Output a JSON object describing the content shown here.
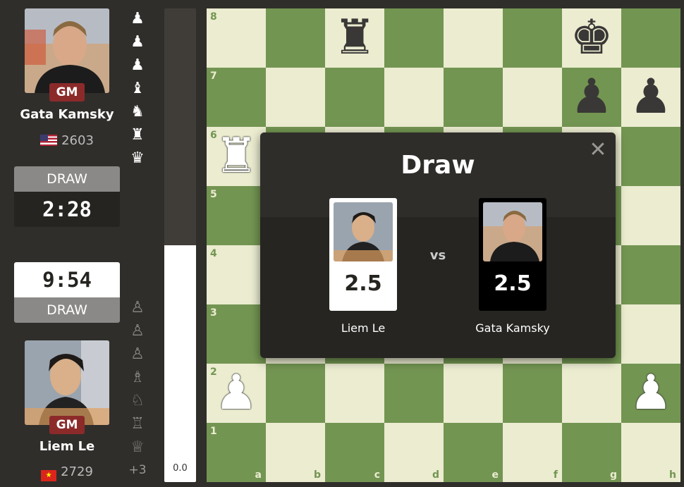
{
  "top_player": {
    "title_badge": "GM",
    "name": "Gata Kamsky",
    "rating": "2603",
    "flag": "us-flag"
  },
  "bottom_player": {
    "title_badge": "GM",
    "name": "Liem Le",
    "rating": "2729",
    "flag": "vn-flag"
  },
  "top_clock": {
    "status": "DRAW",
    "time": "2:28"
  },
  "bottom_clock": {
    "status": "DRAW",
    "time": "9:54"
  },
  "top_captured": [
    "♟",
    "♟",
    "♟",
    "♝",
    "♞",
    "♜",
    "♛"
  ],
  "bottom_captured": [
    "♙",
    "♙",
    "♙",
    "♗",
    "♘",
    "♖",
    "♕"
  ],
  "bottom_advantage": "+3",
  "eval": {
    "score": "0.0",
    "white_fraction": 0.5
  },
  "board": {
    "ranks": [
      "8",
      "7",
      "6",
      "5",
      "4",
      "3",
      "2",
      "1"
    ],
    "files": [
      "a",
      "b",
      "c",
      "d",
      "e",
      "f",
      "g",
      "h"
    ],
    "pieces": [
      {
        "square": "c8",
        "glyph": "♜",
        "color": "black",
        "name": "black-rook-icon"
      },
      {
        "square": "g8",
        "glyph": "♚",
        "color": "black",
        "name": "black-king-icon"
      },
      {
        "square": "g7",
        "glyph": "♟",
        "color": "black",
        "name": "black-pawn-icon"
      },
      {
        "square": "h7",
        "glyph": "♟",
        "color": "black",
        "name": "black-pawn-icon"
      },
      {
        "square": "a6",
        "glyph": "♜",
        "color": "white",
        "name": "white-rook-icon"
      },
      {
        "square": "a2",
        "glyph": "♟",
        "color": "white",
        "name": "white-pawn-icon"
      },
      {
        "square": "h2",
        "glyph": "♟",
        "color": "white",
        "name": "white-pawn-icon"
      }
    ]
  },
  "modal": {
    "title": "Draw",
    "close_icon": "✕",
    "vs": "vs",
    "left": {
      "name": "Liem Le",
      "score": "2.5"
    },
    "right": {
      "name": "Gata Kamsky",
      "score": "2.5"
    }
  },
  "colors": {
    "light_square": "#ebecd0",
    "dark_square": "#739552",
    "badge": "#8c2a2a"
  }
}
